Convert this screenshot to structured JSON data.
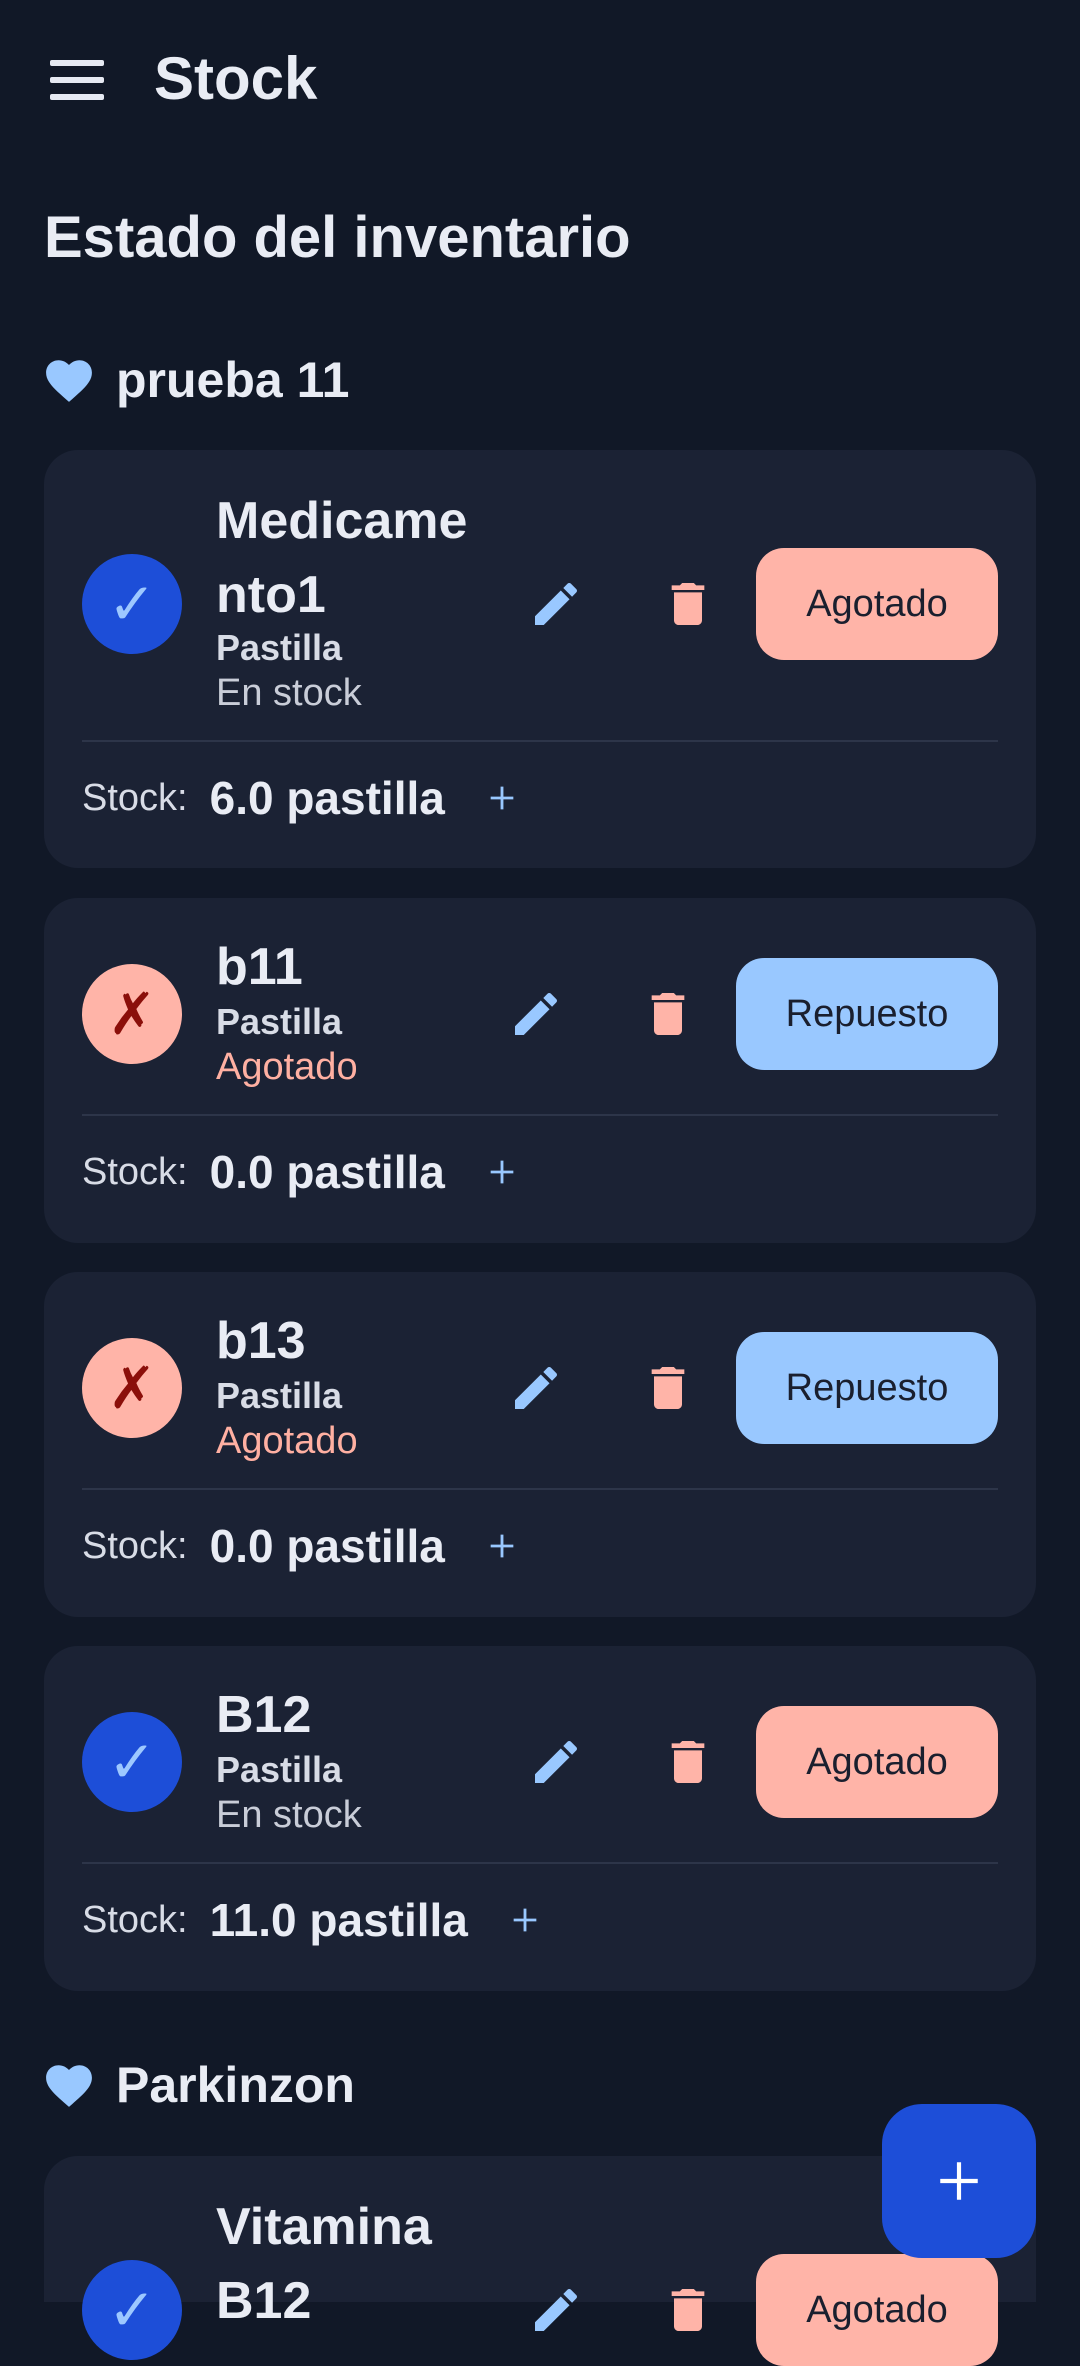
{
  "appbar": {
    "title": "Stock",
    "menu_icon": "menu-icon"
  },
  "page": {
    "heading": "Estado del inventario"
  },
  "groups": [
    {
      "name": "prueba 11",
      "icon": "heart-icon",
      "items": [
        {
          "name_line1": "Medicame",
          "name_line2": "nto1",
          "form": "Pastilla",
          "status": "En stock",
          "status_icon": "check-icon",
          "action_label": "Agotado",
          "stock_label": "Stock:",
          "stock_value": "6.0 pastilla"
        },
        {
          "name_line1": "b11",
          "form": "Pastilla",
          "status": "Agotado",
          "status_icon": "cross-icon",
          "action_label": "Repuesto",
          "stock_label": "Stock:",
          "stock_value": "0.0 pastilla"
        },
        {
          "name_line1": "b13",
          "form": "Pastilla",
          "status": "Agotado",
          "status_icon": "cross-icon",
          "action_label": "Repuesto",
          "stock_label": "Stock:",
          "stock_value": "0.0 pastilla"
        },
        {
          "name_line1": "B12",
          "form": "Pastilla",
          "status": "En stock",
          "status_icon": "check-icon",
          "action_label": "Agotado",
          "stock_label": "Stock:",
          "stock_value": "11.0 pastilla"
        }
      ]
    },
    {
      "name": "Parkinzon",
      "icon": "heart-icon",
      "items": [
        {
          "name_line1": "Vitamina",
          "name_line2": "B12",
          "status_icon": "check-icon",
          "action_label": "Agotado"
        }
      ]
    }
  ],
  "glyphs": {
    "check": "✓",
    "cross": "✗"
  },
  "fab": {
    "icon": "plus-icon"
  },
  "colors": {
    "background": "#111827",
    "card": "#1B2234",
    "primary": "#1D4ED8",
    "light_blue": "#99C8FF",
    "salmon": "#FFB4A8",
    "error_text": "#FFB0A2"
  }
}
